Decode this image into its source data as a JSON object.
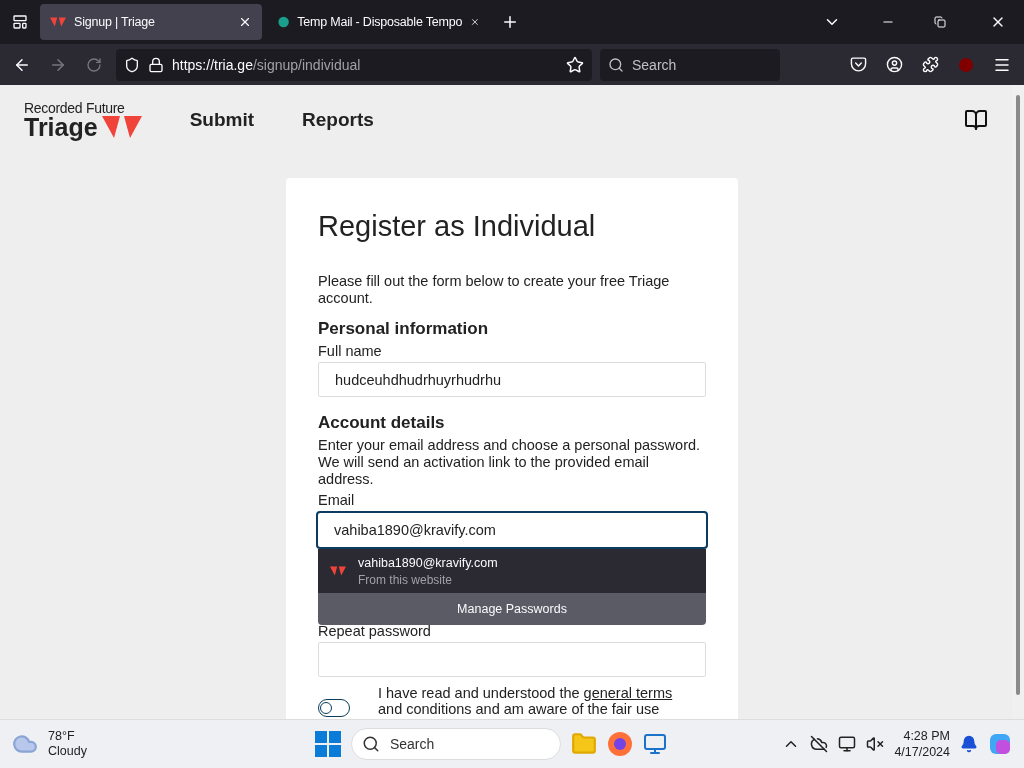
{
  "browser": {
    "tabs": [
      {
        "title": "Signup | Triage",
        "selected": true,
        "kind": "triage"
      },
      {
        "title": "Temp Mail - Disposable Tempo",
        "selected": false,
        "kind": "mail"
      }
    ],
    "url": {
      "host": "https://tria.ge",
      "path": "/signup/individual"
    },
    "search": {
      "placeholder": "Search"
    }
  },
  "site": {
    "brand": "Recorded Future",
    "product": "Triage",
    "nav": [
      "Submit",
      "Reports"
    ]
  },
  "form": {
    "title": "Register as Individual",
    "intro": "Please fill out the form below to create your free Triage account.",
    "personal_heading": "Personal information",
    "full_name": {
      "label": "Full name",
      "value": "hudceuhdhudrhuyrhudrhu"
    },
    "account_heading": "Account details",
    "account_text": "Enter your email address and choose a personal password. We will send an activation link to the provided email address.",
    "email": {
      "label": "Email",
      "value": "vahiba1890@kravify.com"
    },
    "autocomplete": {
      "entry": "vahiba1890@kravify.com",
      "source": "From this website",
      "manage": "Manage Passwords"
    },
    "repeat_password": {
      "label": "Repeat password"
    },
    "terms": {
      "before": "I have read and understood the ",
      "link": "general terms",
      "after": " and conditions and am aware of the fair use",
      "checked": false
    }
  },
  "taskbar": {
    "weather": {
      "temp": "78°F",
      "condition": "Cloudy"
    },
    "search": {
      "placeholder": "Search"
    },
    "clock": {
      "time": "4:28 PM",
      "date": "4/17/2024"
    }
  }
}
